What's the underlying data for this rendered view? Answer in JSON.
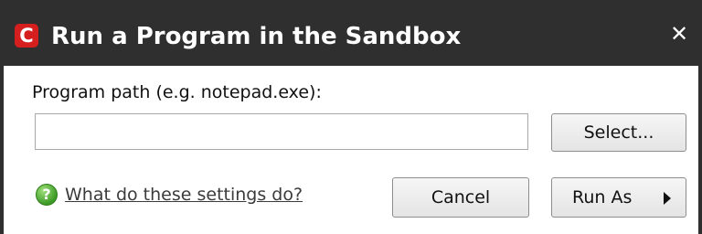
{
  "window": {
    "title": "Run a Program in the Sandbox",
    "app_icon_letter": "C",
    "app_icon_name": "comodo-logo-icon",
    "app_icon_color": "#d51e1e",
    "titlebar_color": "#2f2f2f",
    "close_symbol": "✕"
  },
  "form": {
    "path_label": "Program path (e.g. notepad.exe):",
    "path_value": "",
    "select_label": "Select..."
  },
  "footer": {
    "help_icon_symbol": "?",
    "help_icon_name": "help-icon",
    "help_link": "What do these settings do?",
    "cancel_label": "Cancel",
    "run_as_label": "Run As"
  }
}
